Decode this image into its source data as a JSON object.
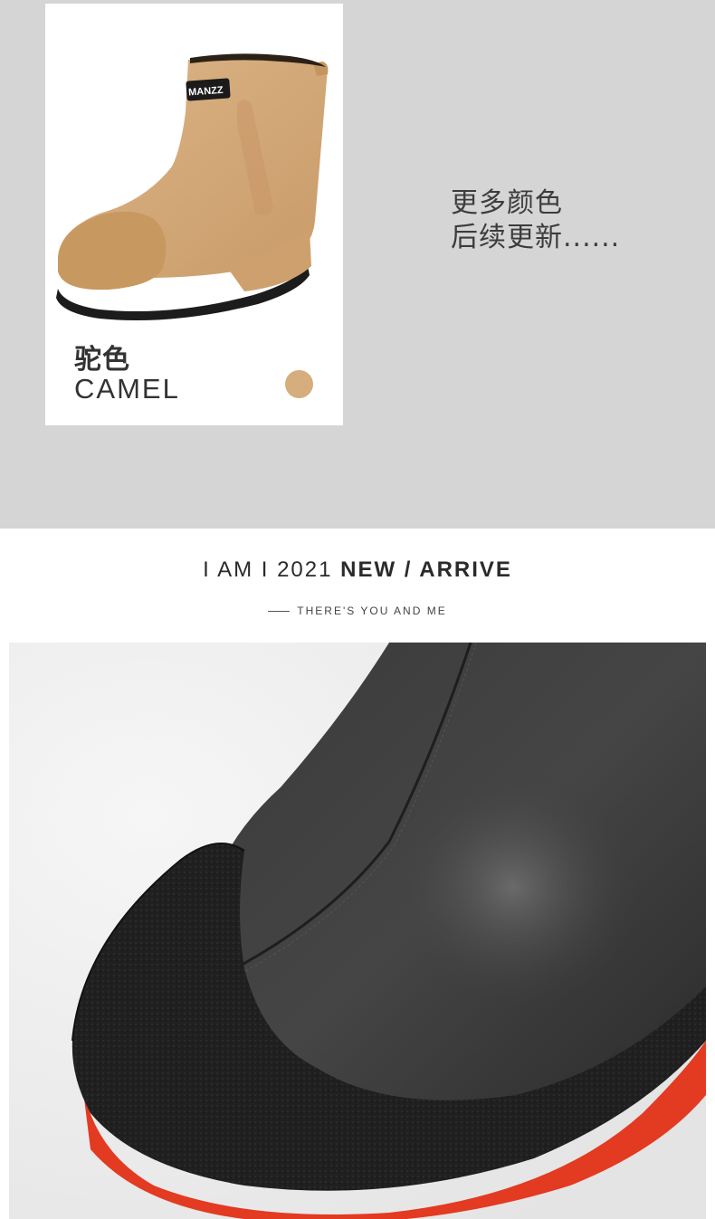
{
  "colors": {
    "background_gray": "#d5d5d5",
    "camel": "#d6ad7c",
    "boot_black": "#2c2c2c",
    "sole_red": "#e83a24"
  },
  "color_card": {
    "brand_label": "MANZZ",
    "name_cn": "驼色",
    "name_en": "CAMEL",
    "swatch_color": "#d6ad7c"
  },
  "more_colors": {
    "line1": "更多颜色",
    "line2": "后续更新......"
  },
  "headline": {
    "part1": "I AM I 2021 ",
    "part2": "NEW / ARRIVE"
  },
  "subline": {
    "text": "THERE'S YOU AND ME"
  }
}
